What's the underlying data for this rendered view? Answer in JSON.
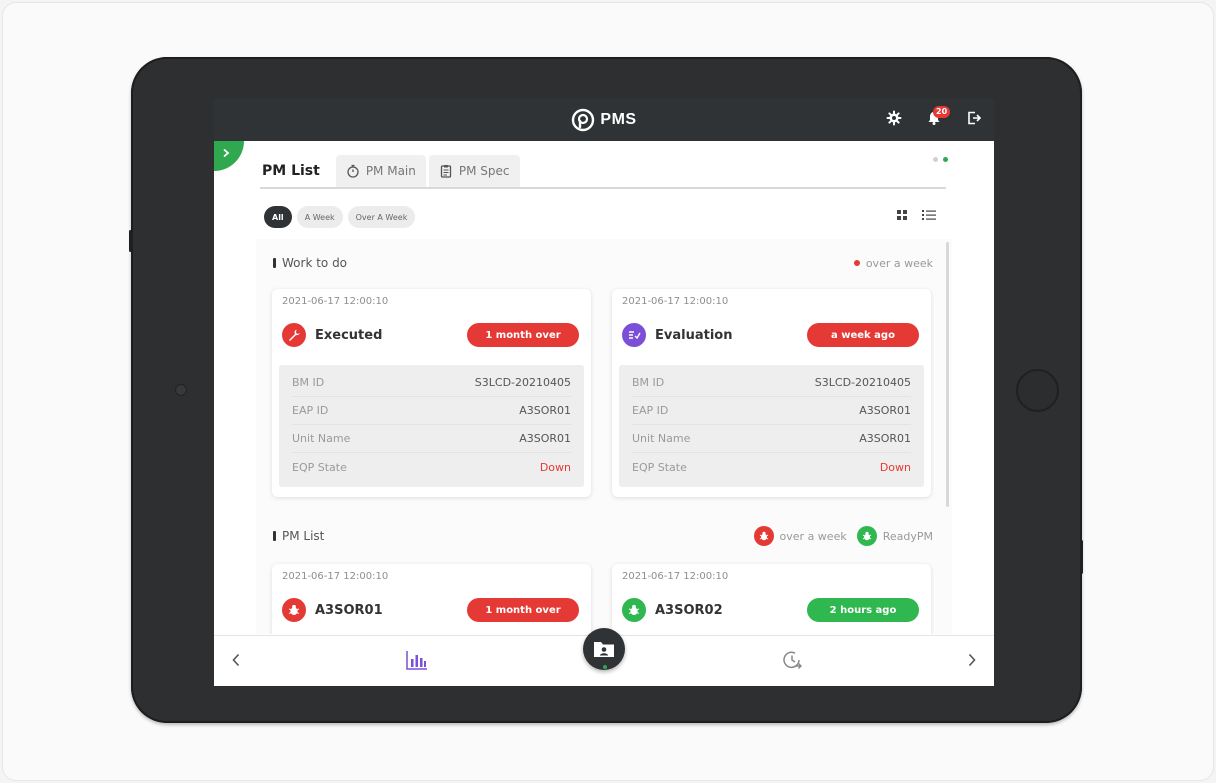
{
  "app": {
    "title": "PMS",
    "notification_count": "20"
  },
  "tabs": [
    {
      "label": "PM List",
      "icon": "list"
    },
    {
      "label": "PM Main",
      "icon": "stopwatch-icon"
    },
    {
      "label": "PM Spec",
      "icon": "clipboard-icon"
    }
  ],
  "filters": {
    "all": "All",
    "a_week": "A Week",
    "over_a_week": "Over A Week"
  },
  "work_to_do": {
    "title": "Work to do",
    "legend": "over a week",
    "cards": [
      {
        "time": "2021-06-17 12:00:10",
        "title": "Executed",
        "icon": "wrench-icon",
        "icon_color": "#e53935",
        "badge": "1 month over",
        "badge_color": "red",
        "fields": [
          {
            "key": "BM ID",
            "value": "S3LCD-20210405"
          },
          {
            "key": "EAP ID",
            "value": "A3SOR01"
          },
          {
            "key": "Unit Name",
            "value": "A3SOR01"
          },
          {
            "key": "EQP State",
            "value": "Down"
          }
        ]
      },
      {
        "time": "2021-06-17 12:00:10",
        "title": "Evaluation",
        "icon": "checklist-icon",
        "icon_color": "#7b4fd6",
        "badge": "a week ago",
        "badge_color": "red",
        "fields": [
          {
            "key": "BM ID",
            "value": "S3LCD-20210405"
          },
          {
            "key": "EAP ID",
            "value": "A3SOR01"
          },
          {
            "key": "Unit Name",
            "value": "A3SOR01"
          },
          {
            "key": "EQP State",
            "value": "Down"
          }
        ]
      }
    ]
  },
  "pm_list": {
    "title": "PM List",
    "legend_over": "over a week",
    "legend_ready": "ReadyPM",
    "cards": [
      {
        "time": "2021-06-17 12:00:10",
        "title": "A3SOR01",
        "icon": "bug-icon",
        "icon_color": "#e53935",
        "badge": "1 month over",
        "badge_color": "red"
      },
      {
        "time": "2021-06-17 12:00:10",
        "title": "A3SOR02",
        "icon": "bug-icon",
        "icon_color": "#2fb84f",
        "badge": "2 hours ago",
        "badge_color": "green"
      }
    ]
  },
  "colors": {
    "accent_green": "#2fa84f",
    "alert_red": "#e53935",
    "topbar": "#2f3336",
    "chart_purple": "#7b4fd6"
  }
}
